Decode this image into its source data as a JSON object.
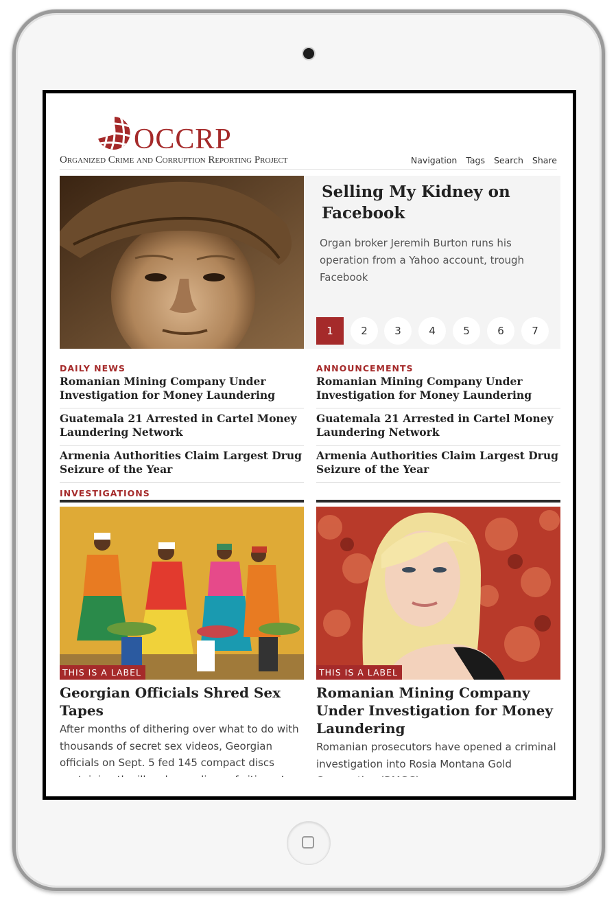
{
  "site": {
    "logo_text": "OCCRP",
    "tagline": "Organized Crime and Corruption Reporting Project",
    "nav": [
      "Navigation",
      "Tags",
      "Search",
      "Share"
    ]
  },
  "hero": {
    "title": "Selling My Kidney on Facebook",
    "description": "Organ broker Jeremih Burton runs his operation from a Yahoo account, trough Facebook",
    "pages": [
      "1",
      "2",
      "3",
      "4",
      "5",
      "6",
      "7"
    ],
    "active_page": 1
  },
  "daily_news": {
    "heading": "DAILY NEWS",
    "items": [
      "Romanian Mining Company Under Investigation for Money Laundering",
      "Guatemala 21 Arrested in Cartel Money Laundering Network",
      "Armenia Authorities Claim Largest Drug Seizure of the Year"
    ]
  },
  "announcements": {
    "heading": "ANNOUNCEMENTS",
    "items": [
      "Romanian Mining Company Under Investigation for Money Laundering",
      "Guatemala 21 Arrested in Cartel Money Laundering Network",
      "Armenia Authorities Claim Largest Drug Seizure of the Year"
    ]
  },
  "investigations": {
    "heading": "INVESTIGATIONS",
    "cards": [
      {
        "label": "THIS IS A LABEL",
        "title": "Georgian Officials Shred Sex Tapes",
        "description": "After months of dithering over what to do with thousands of secret sex videos, Georgian officials on Sept. 5 fed 145 compact discs containing the illegal recordings of citizens’ sex lives into a"
      },
      {
        "label": "THIS IS A LABEL",
        "title": "Romanian Mining Company Under Investigation for Money Laundering",
        "description": "Romanian prosecutors have opened a criminal investigation into Rosia Montana Gold Corporation (RMGC)"
      }
    ]
  },
  "colors": {
    "brand": "#a52a2a",
    "panel": "#f4f4f4",
    "text": "#222222"
  }
}
